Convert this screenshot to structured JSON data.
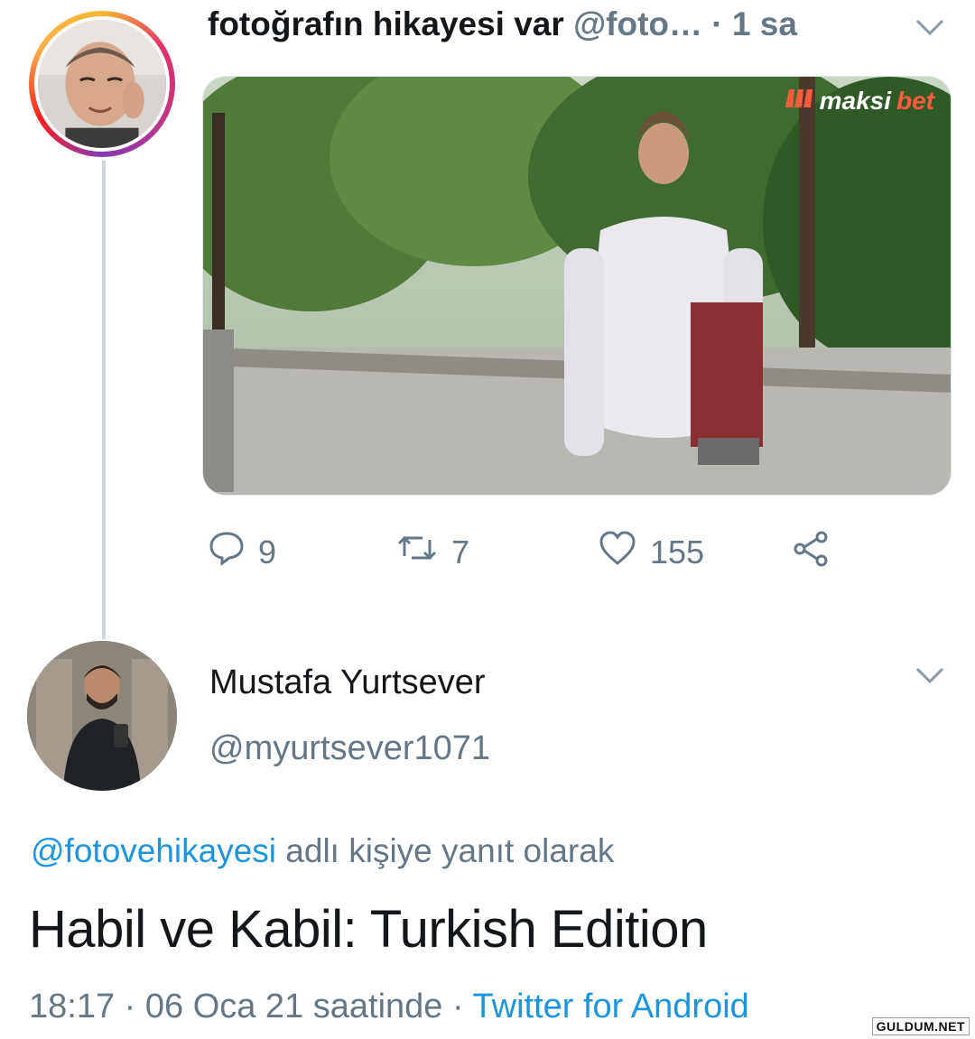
{
  "tweet1": {
    "display_name": "fotoğrafın hikayesi var",
    "handle": "@foto…",
    "separator": "·",
    "time": "1 sa",
    "media": {
      "watermark": {
        "brand_a": "maksi",
        "brand_b": "bet"
      }
    },
    "actions": {
      "replies": "9",
      "retweets": "7",
      "likes": "155"
    }
  },
  "tweet2": {
    "display_name": "Mustafa Yurtsever",
    "handle": "@myurtsever1071",
    "reply_to": {
      "mention": "@fotovehikayesi",
      "suffix": " adlı kişiye yanıt olarak"
    },
    "text": "Habil ve Kabil: Turkish Edition",
    "meta": {
      "timestamp": "18:17 · 06 Oca 21 saatinde",
      "separator": " · ",
      "source": "Twitter for Android"
    }
  },
  "site_watermark": "GULDUM.NET",
  "colors": {
    "link": "#1b95e0",
    "muted": "#657786",
    "text": "#14171a",
    "thread_line": "#ccd6dd"
  },
  "icons": [
    "reply-icon",
    "retweet-icon",
    "like-icon",
    "share-icon",
    "chevron-down-icon"
  ]
}
